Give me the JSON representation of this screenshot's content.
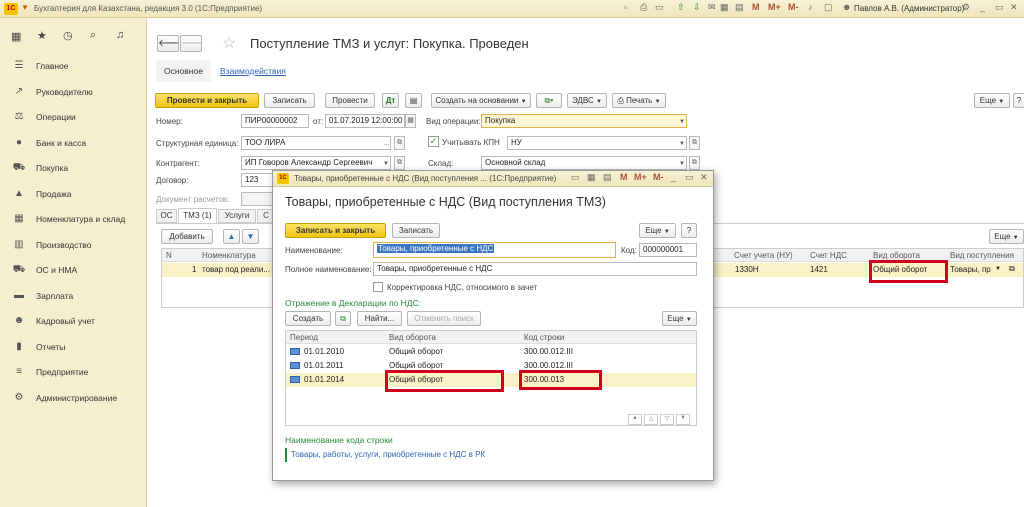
{
  "titlebar": {
    "app_title": "Бухгалтерия для Казахстана, редакция 3.0  (1С:Предприятие)",
    "user": "Павлов А.В. (Администратор)"
  },
  "sidebar": {
    "items": [
      {
        "label": "Главное",
        "icon": "menu-icon"
      },
      {
        "label": "Руководителю",
        "icon": "chart-icon"
      },
      {
        "label": "Операции",
        "icon": "balance-icon"
      },
      {
        "label": "Банк и касса",
        "icon": "coins-icon"
      },
      {
        "label": "Покупка",
        "icon": "cart-icon"
      },
      {
        "label": "Продажа",
        "icon": "bag-icon"
      },
      {
        "label": "Номенклатура и склад",
        "icon": "warehouse-icon"
      },
      {
        "label": "Производство",
        "icon": "factory-icon"
      },
      {
        "label": "ОС и НМА",
        "icon": "truck-icon"
      },
      {
        "label": "Зарплата",
        "icon": "money-icon"
      },
      {
        "label": "Кадровый учет",
        "icon": "people-icon"
      },
      {
        "label": "Отчеты",
        "icon": "bars-icon"
      },
      {
        "label": "Предприятие",
        "icon": "list-icon"
      },
      {
        "label": "Администрирование",
        "icon": "gear-icon"
      }
    ]
  },
  "doc": {
    "title": "Поступление ТМЗ и услуг: Покупка. Проведен",
    "tab_main": "Основное",
    "tab_links": "Взаимодействия",
    "btn_post_close": "Провести и закрыть",
    "btn_save": "Записать",
    "btn_post": "Провести",
    "btn_create_basis": "Создать на основании",
    "btn_edvs": "ЭДВС",
    "btn_print": "Печать",
    "btn_more": "Еще",
    "lbl_number": "Номер:",
    "number": "ПИР00000002",
    "lbl_from": "от:",
    "date": "01.07.2019 12:00:00",
    "lbl_op": "Вид операции:",
    "op": "Покупка",
    "lbl_unit": "Структурная единица:",
    "unit": "ТОО ЛИРА",
    "lbl_kpn": "Учитывать КПН",
    "kpn": "НУ",
    "lbl_contractor": "Контрагент:",
    "contractor": "ИП Говоров Александр Сергеевич",
    "lbl_warehouse": "Склад:",
    "warehouse": "Основной склад",
    "lbl_contract": "Договор:",
    "contract": "123",
    "lbl_settle": "Документ расчетов:",
    "tabs": [
      "ОС",
      "ТМЗ (1)",
      "Услуги",
      "С"
    ],
    "btn_add": "Добавить",
    "table": {
      "headers": [
        "N",
        "Номенклатура",
        "Счет учета (НУ)",
        "Счет НДС",
        "Вид оборота",
        "Вид поступления"
      ],
      "row": {
        "n": "1",
        "item": "товар под реали...",
        "acc_nu": "1330Н",
        "acc_vat": "1421",
        "turnover": "Общий оборот",
        "receipt": "Товары, пр"
      }
    }
  },
  "dialog": {
    "window_title": "Товары, приобретенные с НДС (Вид поступления ... (1С:Предприятие)",
    "title": "Товары, приобретенные с НДС (Вид поступления ТМЗ)",
    "btn_save_close": "Записать и закрыть",
    "btn_save": "Записать",
    "btn_more": "Еще",
    "btn_help": "?",
    "lbl_name": "Наименование:",
    "name": "Товары, приобретенные с НДС",
    "lbl_code": "Код:",
    "code": "000000001",
    "lbl_fullname": "Полное наименование:",
    "fullname": "Товары, приобретенные с НДС",
    "chk_vat": "Корректировка НДС, относимого в зачет",
    "section": "Отражение в Декларации по НДС:",
    "btn_create": "Создать",
    "btn_find": "Найти...",
    "btn_cancel_find": "Отменить поиск",
    "table": {
      "headers": [
        "Период",
        "Вид оборота",
        "Код строки"
      ],
      "rows": [
        {
          "period": "01.01.2010",
          "turnover": "Общий оборот",
          "code": "300.00.012.III"
        },
        {
          "period": "01.01.2011",
          "turnover": "Общий оборот",
          "code": "300.00.012.III"
        },
        {
          "period": "01.01.2014",
          "turnover": "Общий оборот",
          "code": "300.00.013"
        }
      ]
    },
    "code_name_title": "Наименование кода строки",
    "code_name": "Товары, работы, услуги, приобретенные с НДС в РК"
  }
}
